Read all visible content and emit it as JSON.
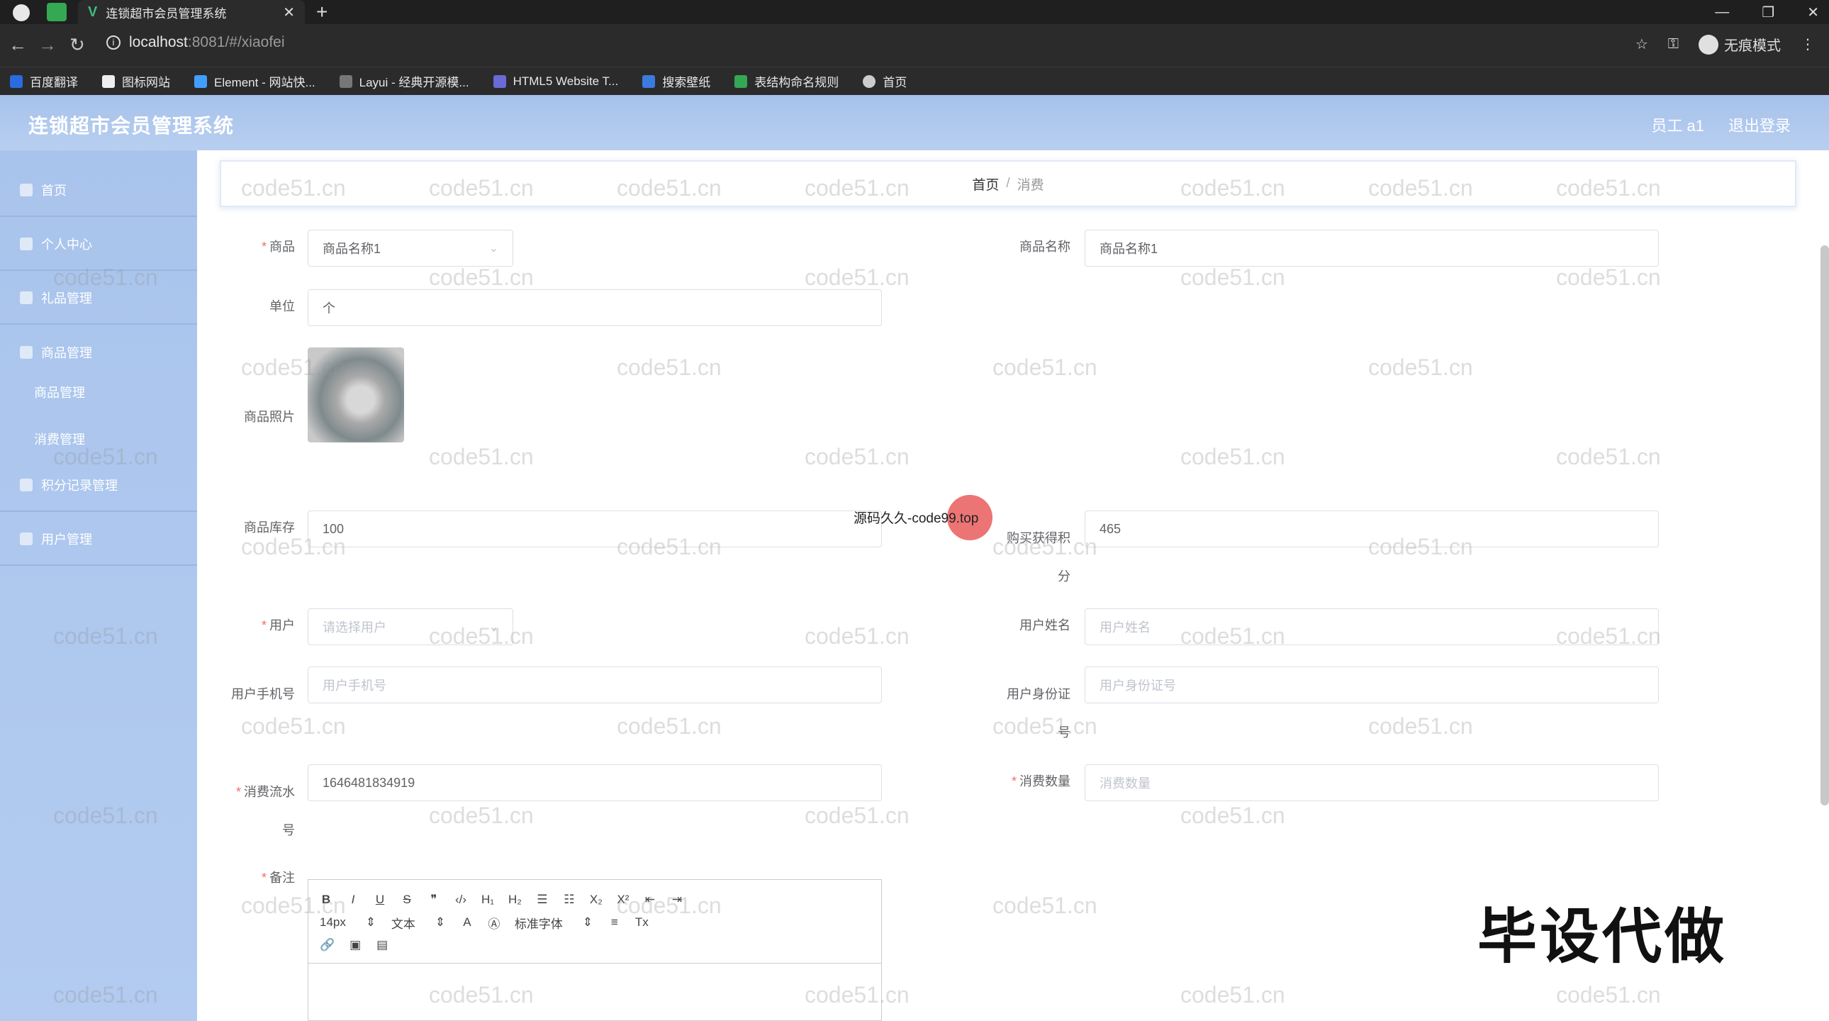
{
  "browser": {
    "tab_title": "连锁超市会员管理系统",
    "url_host": "localhost",
    "url_rest": ":8081/#/xiaofei",
    "incognito_label": "无痕模式",
    "bookmarks": [
      "百度翻译",
      "图标网站",
      "Element - 网站快...",
      "Layui - 经典开源模...",
      "HTML5 Website T...",
      "搜索壁纸",
      "表结构命名规则",
      "首页"
    ]
  },
  "header": {
    "title": "连锁超市会员管理系统",
    "user": "员工 a1",
    "logout": "退出登录"
  },
  "sidebar": {
    "items": [
      "首页",
      "个人中心",
      "礼品管理",
      "商品管理",
      "积分记录管理",
      "用户管理"
    ],
    "sub_items": [
      "商品管理",
      "消费管理"
    ]
  },
  "breadcrumb": {
    "home": "首页",
    "separator": "/",
    "current": "消费"
  },
  "form": {
    "product_label": "商品",
    "product_value": "商品名称1",
    "product_name_label": "商品名称",
    "product_name_value": "商品名称1",
    "unit_label": "单位",
    "unit_value": "个",
    "photo_label": "商品照片",
    "stock_label": "商品库存",
    "stock_value": "100",
    "points_label": "购买获得积分",
    "points_value": "465",
    "user_label": "用户",
    "user_placeholder": "请选择用户",
    "username_label": "用户姓名",
    "username_placeholder": "用户姓名",
    "phone_label": "用户手机号",
    "phone_placeholder": "用户手机号",
    "idcard_label": "用户身份证号",
    "idcard_placeholder": "用户身份证号",
    "serial_label": "消费流水号",
    "serial_value": "1646481834919",
    "qty_label": "消费数量",
    "qty_placeholder": "消费数量",
    "remark_label": "备注"
  },
  "editor": {
    "font_size": "14px",
    "text_type": "文本",
    "font_family": "标准字体"
  },
  "overlays": {
    "watermark": "code51.cn",
    "source_text": "源码久久-code99.top",
    "biz_text": "毕设代做"
  }
}
